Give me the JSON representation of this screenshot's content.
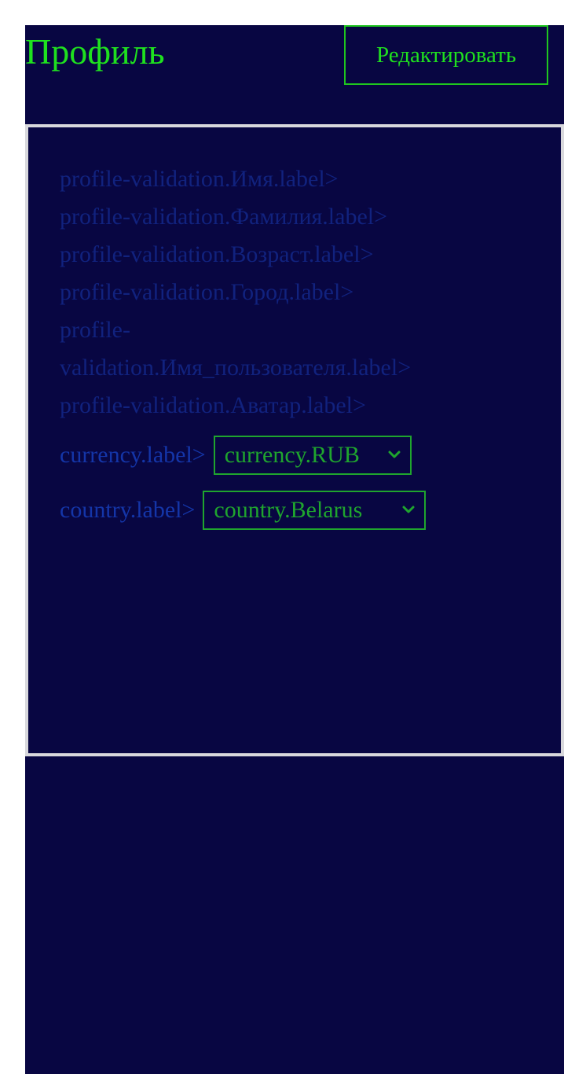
{
  "header": {
    "title": "Профиль",
    "edit_label": "Редактировать"
  },
  "profile_fields": [
    {
      "label": "profile-validation.Имя.label>"
    },
    {
      "label": "profile-validation.Фамилия.label>"
    },
    {
      "label": "profile-validation.Возраст.label>"
    },
    {
      "label": "profile-validation.Город.label>"
    },
    {
      "label": "profile-validation.Имя_пользователя.label>"
    },
    {
      "label": "profile-validation.Аватар.label>"
    }
  ],
  "currency": {
    "label": "currency.label>",
    "selected": "currency.RUB"
  },
  "country": {
    "label": "country.label>",
    "selected": "country.Belarus"
  },
  "colors": {
    "background": "#080642",
    "accent": "#1fe01f",
    "select_border": "#1fa52e",
    "label_text": "#11227e",
    "panel_border": "#d8d8dc"
  },
  "icons": {
    "select_arrow": "chevron-down-icon"
  }
}
